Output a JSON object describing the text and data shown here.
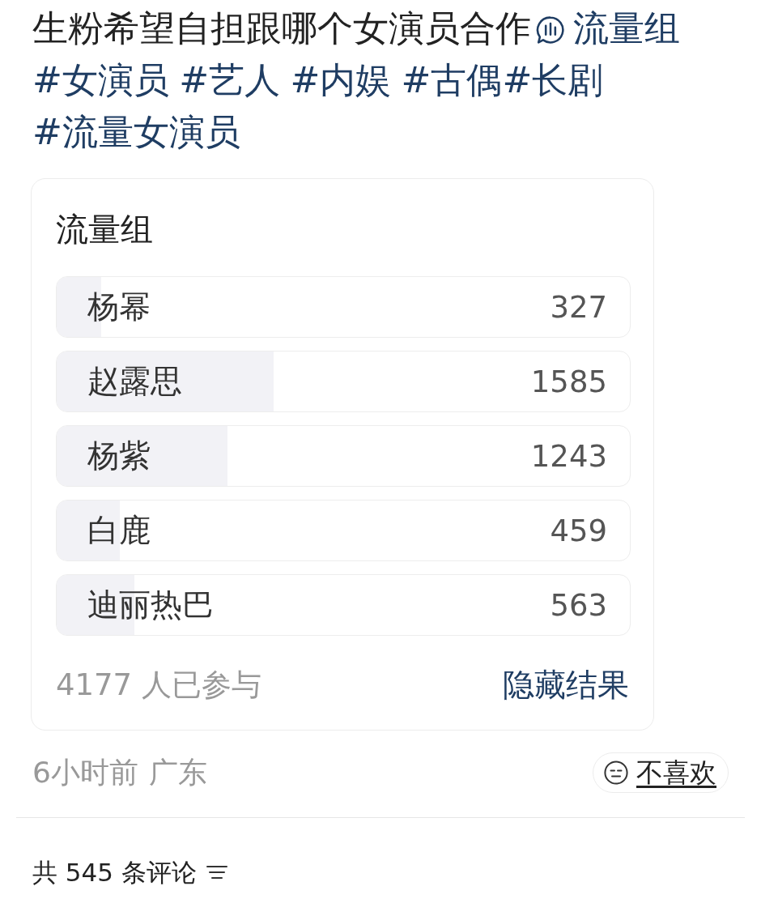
{
  "post": {
    "title": "生粉希望自担跟哪个女演员合作",
    "poll_link": "流量组",
    "hashtag_groups": [
      [
        "#女演员"
      ],
      [
        "#艺人"
      ],
      [
        "#内娱"
      ],
      [
        "#古偶",
        "#长剧"
      ],
      [
        "#流量女演员"
      ]
    ]
  },
  "poll": {
    "title": "流量组",
    "options": [
      {
        "name": "杨幂",
        "count": "327",
        "level": 0.078
      },
      {
        "name": "赵露思",
        "count": "1585",
        "level": 0.379
      },
      {
        "name": "杨紫",
        "count": "1243",
        "level": 0.298
      },
      {
        "name": "白鹿",
        "count": "459",
        "level": 0.11
      },
      {
        "name": "迪丽热巴",
        "count": "563",
        "level": 0.135
      }
    ],
    "participants": "4177 人已参与",
    "hide_results": "隐藏结果"
  },
  "meta": {
    "time": "6小时前",
    "location": "广东",
    "dislike": "不喜欢"
  },
  "comments": {
    "count_label": "共 545 条评论"
  }
}
